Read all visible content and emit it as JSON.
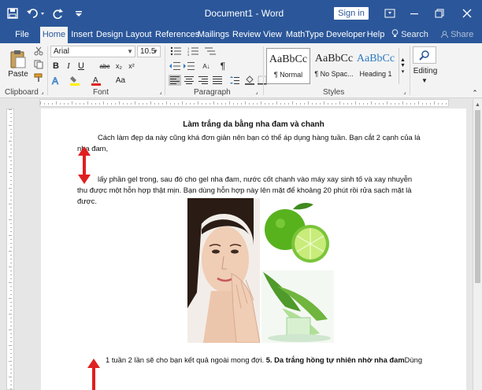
{
  "window": {
    "title": "Document1  -  Word",
    "sign_in": "Sign in"
  },
  "tabs": [
    "File",
    "Home",
    "Insert",
    "Design",
    "Layout",
    "References",
    "Mailings",
    "Review",
    "View",
    "MathType",
    "Developer",
    "Help"
  ],
  "active_tab": "Home",
  "search_label": "Search",
  "share_label": "Share",
  "ribbon": {
    "clipboard": {
      "paste": "Paste",
      "label": "Clipboard"
    },
    "font": {
      "name": "Arial",
      "size": "10.5",
      "label": "Font",
      "aa": "Aa"
    },
    "paragraph": {
      "label": "Paragraph"
    },
    "styles": {
      "label": "Styles",
      "items": [
        {
          "preview": "AaBbCc",
          "name": "¶ Normal"
        },
        {
          "preview": "AaBbCc",
          "name": "¶ No Spac..."
        },
        {
          "preview": "AaBbCc",
          "name": "Heading 1"
        }
      ]
    },
    "editing": {
      "label": "Editing"
    }
  },
  "document": {
    "title": "Làm trắng da bằng nha đam và chanh",
    "para1": "Cách làm đẹp da này cũng khá đơn giản nên bạn có thể áp dụng hàng tuần. Bạn cắt 2 cạnh của lá nha đam,",
    "para2": "lấy phần gel trong, sau đó cho gel nha đam, nước cốt chanh vào máy xay sinh tố và xay nhuyễn thu được một hỗn hợp thật mịn. Bạn dùng hỗn hợp này lên mặt để khoảng 20 phút rồi rửa sạch mặt là được.",
    "para3_plain": "1 tuần 2 lần sẽ cho bạn kết quả ngoài mong đợi.",
    "para3_bold": "5. Da trắng hồng tự nhiên nhờ nha đam",
    "para3_tail": "Dùng"
  },
  "colors": {
    "brand": "#2b579a",
    "arrow": "#e02020"
  }
}
